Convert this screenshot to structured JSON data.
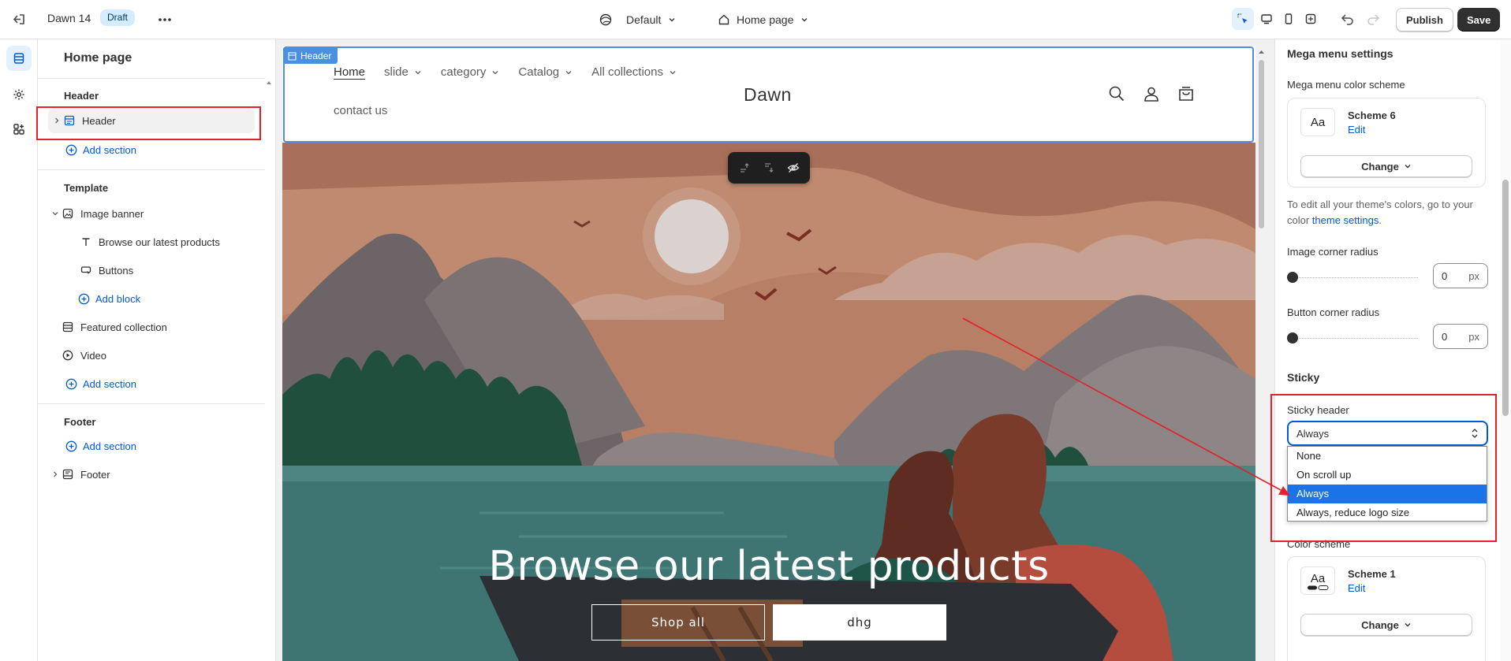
{
  "topbar": {
    "theme_name": "Dawn 14",
    "status_badge": "Draft",
    "template_dropdown": "Default",
    "page_dropdown": "Home page",
    "publish_label": "Publish",
    "save_label": "Save"
  },
  "sidebar": {
    "title": "Home page",
    "header_group": "Header",
    "header_section": "Header",
    "add_section": "Add section",
    "template_group": "Template",
    "image_banner": "Image banner",
    "banner_text_block": "Browse our latest products",
    "banner_buttons_block": "Buttons",
    "add_block": "Add block",
    "featured_collection": "Featured collection",
    "video": "Video",
    "footer_group": "Footer",
    "footer_section": "Footer"
  },
  "preview": {
    "header_tag": "Header",
    "nav": [
      "Home",
      "slide",
      "category",
      "Catalog",
      "All collections"
    ],
    "nav_second_row": "contact us",
    "logo": "Dawn",
    "hero_title": "Browse our latest products",
    "button_primary": "Shop all",
    "button_secondary": "dhg"
  },
  "settings": {
    "mega_menu_heading": "Mega menu settings",
    "mega_menu_color_label": "Mega menu color scheme",
    "mega_scheme_name": "Scheme 6",
    "swatch_text": "Aa",
    "edit_label": "Edit",
    "change_label": "Change",
    "help_prefix": "To edit all your theme's colors, go to your color ",
    "help_link": "theme settings",
    "help_suffix": ".",
    "image_radius_label": "Image corner radius",
    "image_radius_value": "0",
    "button_radius_label": "Button corner radius",
    "button_radius_value": "0",
    "unit": "px",
    "sticky_heading": "Sticky",
    "sticky_label": "Sticky header",
    "sticky_value": "Always",
    "sticky_options": [
      "None",
      "On scroll up",
      "Always",
      "Always, reduce logo size"
    ],
    "color_scheme_label": "Color scheme",
    "color_scheme_name": "Scheme 1"
  },
  "colors": {
    "accent": "#005bd3",
    "selection_outline": "#4a90e2",
    "annotation": "#e6202a",
    "save_button": "#303030",
    "dropdown_selected": "#1a73e8"
  }
}
